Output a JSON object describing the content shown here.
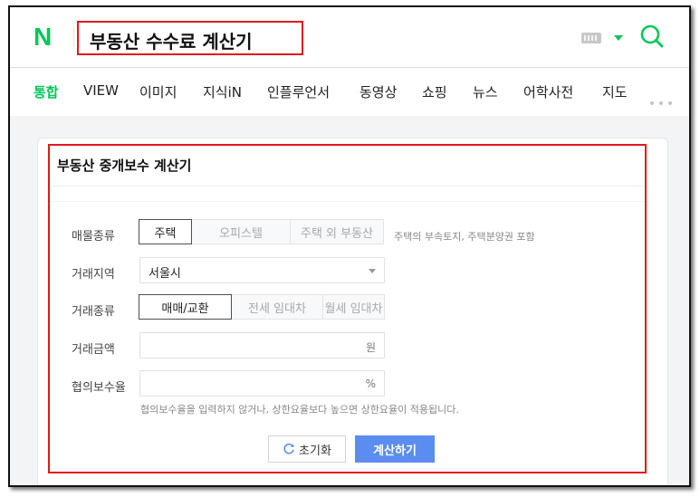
{
  "header": {
    "logo": "N",
    "query": "부동산 수수료 계산기"
  },
  "nav": {
    "tabs": [
      {
        "label": "통합",
        "active": true
      },
      {
        "label": "VIEW"
      },
      {
        "label": "이미지"
      },
      {
        "label": "지식iN"
      },
      {
        "label": "인플루언서"
      },
      {
        "label": "동영상"
      },
      {
        "label": "쇼핑"
      },
      {
        "label": "뉴스"
      },
      {
        "label": "어학사전"
      },
      {
        "label": "지도"
      }
    ]
  },
  "calculator": {
    "title": "부동산 중개보수 계산기",
    "property_type": {
      "label": "매물종류",
      "options": [
        "주택",
        "오피스텔",
        "주택 외 부동산"
      ],
      "selected": "주택",
      "hint": "주택의 부속토지, 주택분양권 포함"
    },
    "region": {
      "label": "거래지역",
      "value": "서울시"
    },
    "deal_type": {
      "label": "거래종류",
      "options": [
        "매매/교환",
        "전세 임대차",
        "월세 임대차"
      ],
      "selected": "매매/교환"
    },
    "amount": {
      "label": "거래금액",
      "value": "",
      "unit": "원"
    },
    "rate": {
      "label": "협의보수율",
      "value": "",
      "unit": "%",
      "hint": "협의보수율을 입력하지 않거나, 상한요율보다 높으면 상한요율이 적용됩니다."
    },
    "buttons": {
      "reset": "초기화",
      "calculate": "계산하기"
    }
  },
  "colors": {
    "brand": "#03c75a",
    "highlight_border": "#e0191c",
    "primary_button": "#5b8df0"
  }
}
